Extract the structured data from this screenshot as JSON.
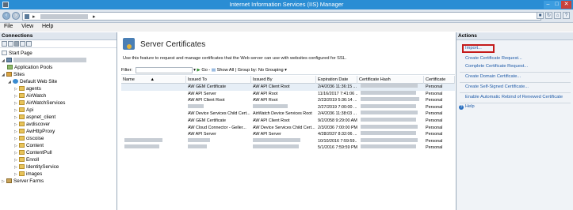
{
  "window": {
    "title": "Internet Information Services (IIS) Manager"
  },
  "menu": [
    "File",
    "View",
    "Help"
  ],
  "connections": {
    "header": "Connections",
    "tree": [
      {
        "label": "Start Page",
        "icon": "page-icon",
        "level": 0
      },
      {
        "label": "",
        "icon": "server-icon",
        "level": 0,
        "redacted": true
      },
      {
        "label": "Application Pools",
        "icon": "pool-icon",
        "level": 1
      },
      {
        "label": "Sites",
        "icon": "sites-icon",
        "level": 1
      },
      {
        "label": "Default Web Site",
        "icon": "globe-icon",
        "level": 2
      },
      {
        "label": "agents",
        "icon": "folder-icon",
        "level": 3
      },
      {
        "label": "AirWatch",
        "icon": "folder-icon",
        "level": 3
      },
      {
        "label": "AirWatchServices",
        "icon": "folder-icon",
        "level": 3
      },
      {
        "label": "Api",
        "icon": "folder-icon",
        "level": 3
      },
      {
        "label": "aspnet_client",
        "icon": "folder-icon",
        "level": 3
      },
      {
        "label": "avdiscover",
        "icon": "folder-icon",
        "level": 3
      },
      {
        "label": "AwHttpProxy",
        "icon": "folder-icon",
        "level": 3
      },
      {
        "label": "ciscoise",
        "icon": "folder-icon",
        "level": 3
      },
      {
        "label": "Content",
        "icon": "folder-icon",
        "level": 3
      },
      {
        "label": "ContentPull",
        "icon": "folder-icon",
        "level": 3
      },
      {
        "label": "Enroll",
        "icon": "folder-icon",
        "level": 3
      },
      {
        "label": "IdentityService",
        "icon": "folder-icon",
        "level": 3
      },
      {
        "label": "images",
        "icon": "folder-icon",
        "level": 3
      },
      {
        "label": "Server Farms",
        "icon": "farm-icon",
        "level": 0
      }
    ]
  },
  "main": {
    "title": "Server Certificates",
    "description": "Use this feature to request and manage certificates that the Web server can use with websites configured for SSL.",
    "filter": {
      "label": "Filter:",
      "go": "Go",
      "show_all": "Show All",
      "group_by_label": "Group by:",
      "group_by_value": "No Grouping"
    },
    "columns": [
      "Name",
      "Issued To",
      "Issued By",
      "Expiration Date",
      "Certificate Hash",
      "Certificate"
    ],
    "rows": [
      {
        "issued_to": "AW GEM Certificate",
        "issued_by": "AW API Client Root",
        "expiration": "2/4/2036 11:36:15 ...",
        "store": "Personal"
      },
      {
        "issued_to": "AW API Server",
        "issued_by": "AW API Root",
        "expiration": "11/16/2017 7:41:06 ...",
        "store": "Personal"
      },
      {
        "issued_to": "AW API Client Root",
        "issued_by": "AW API Root",
        "expiration": "2/23/2019 5:36:14 ...",
        "store": "Personal"
      },
      {
        "issued_to": "",
        "issued_by": "",
        "expiration": "2/27/2019 7:00:00 ...",
        "store": "Personal"
      },
      {
        "issued_to": "AW Device Services Child Cert...",
        "issued_by": "AirWatch Device Services Root",
        "expiration": "2/4/2036 11:38:03 ...",
        "store": "Personal"
      },
      {
        "issued_to": "AW GEM Certificate",
        "issued_by": "AW API Client Root",
        "expiration": "9/2/2058 9:29:00 AM",
        "store": "Personal"
      },
      {
        "issued_to": "AW Cloud Connector - Geller...",
        "issued_by": "AW Device Services Child Cert...",
        "expiration": "2/3/2036 7:00:00 PM",
        "store": "Personal"
      },
      {
        "issued_to": "AW API Server",
        "issued_by": "AW API Server",
        "expiration": "4/28/2037 8:32:06 ...",
        "store": "Personal"
      },
      {
        "issued_to": "",
        "issued_by": "",
        "expiration": "10/10/2016 7:59:59...",
        "store": "Personal"
      },
      {
        "issued_to": "",
        "issued_by": "",
        "expiration": "5/1/2016 7:59:59 PM",
        "store": "Personal"
      }
    ]
  },
  "actions": {
    "header": "Actions",
    "items": [
      "Import...",
      "Create Certificate Request...",
      "Complete Certificate Request...",
      "Create Domain Certificate...",
      "Create Self-Signed Certificate...",
      "Enable Automatic Rebind of Renewed Certificate",
      "Help"
    ]
  },
  "colors": {
    "titlebar": "#2a8dd4",
    "link": "#1f5ba8",
    "highlight": "#c41a1a"
  }
}
